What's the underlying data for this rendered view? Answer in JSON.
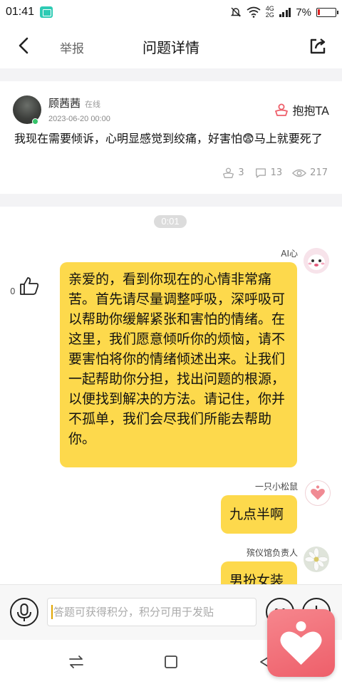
{
  "status_bar": {
    "time": "01:41",
    "network_top": "4G",
    "network_bottom": "2G",
    "battery": "7%"
  },
  "nav": {
    "report_label": "举报",
    "title": "问题详情"
  },
  "question": {
    "author_name": "顾茜茜",
    "online_label": "在线",
    "timestamp": "2023-06-20 00:00",
    "hug_label": "抱抱TA",
    "text_part1": "我现在需要倾诉，心明显感觉到绞痛，好害怕",
    "text_emoji": "😨",
    "text_part2": "马上就要死了",
    "hugs_count": "3",
    "comments_count": "13",
    "views_count": "217"
  },
  "chat": {
    "timer": "0:01",
    "messages": [
      {
        "sender": "AI心",
        "likes": "0",
        "text": "亲爱的，看到你现在的心情非常痛苦。首先请尽量调整呼吸，深呼吸可以帮助你缓解紧张和害怕的情绪。在这里，我们愿意倾听你的烦恼，请不要害怕将你的情绪倾述出来。让我们一起帮助你分担，找出问题的根源，以便找到解决的方法。请记住，你并不孤单，我们会尽我们所能去帮助你。"
      },
      {
        "sender": "一只小松鼠",
        "text": "九点半啊"
      },
      {
        "sender": "殡仪馆负责人",
        "text": "男扮女装"
      }
    ]
  },
  "input": {
    "placeholder": "答题可获得积分，积分可用于发贴"
  },
  "colors": {
    "bubble": "#fdd94c",
    "accent_red": "#ee5f6a",
    "online_green": "#36c46a"
  },
  "icons": [
    "back-icon",
    "share-icon",
    "hug-icon",
    "mic-icon",
    "emoji-icon",
    "plus-icon",
    "thumbs-up-icon",
    "heart-icon"
  ]
}
